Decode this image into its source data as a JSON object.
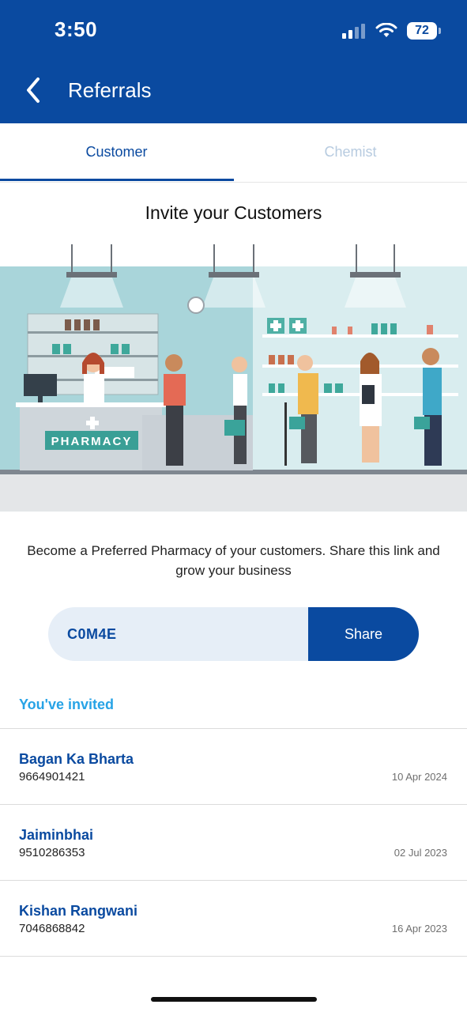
{
  "status_bar": {
    "time": "3:50",
    "battery": "72",
    "icons": [
      "signal-icon",
      "wifi-icon",
      "battery-icon"
    ]
  },
  "nav": {
    "back_icon": "chevron-left-icon",
    "title": "Referrals"
  },
  "tabs": [
    {
      "label": "Customer",
      "active": true
    },
    {
      "label": "Chemist",
      "active": false
    }
  ],
  "section_title": "Invite your Customers",
  "illustration": {
    "sign_text": "PHARMACY"
  },
  "description": "Become a Preferred Pharmacy of your customers. Share this link and grow your business",
  "referral": {
    "code": "C0M4E",
    "share_label": "Share"
  },
  "invited": {
    "label": "You've invited",
    "items": [
      {
        "name": "Bagan Ka Bharta",
        "phone": "9664901421",
        "date": "10 Apr 2024"
      },
      {
        "name": "Jaiminbhai",
        "phone": "9510286353",
        "date": "02 Jul 2023"
      },
      {
        "name": "Kishan Rangwani",
        "phone": "7046868842",
        "date": "16 Apr 2023"
      }
    ]
  },
  "colors": {
    "brand": "#0a4aa0",
    "accent_light": "#27a3e6",
    "tab_inactive": "#b7cbe0",
    "code_bg": "#e6eef7"
  }
}
